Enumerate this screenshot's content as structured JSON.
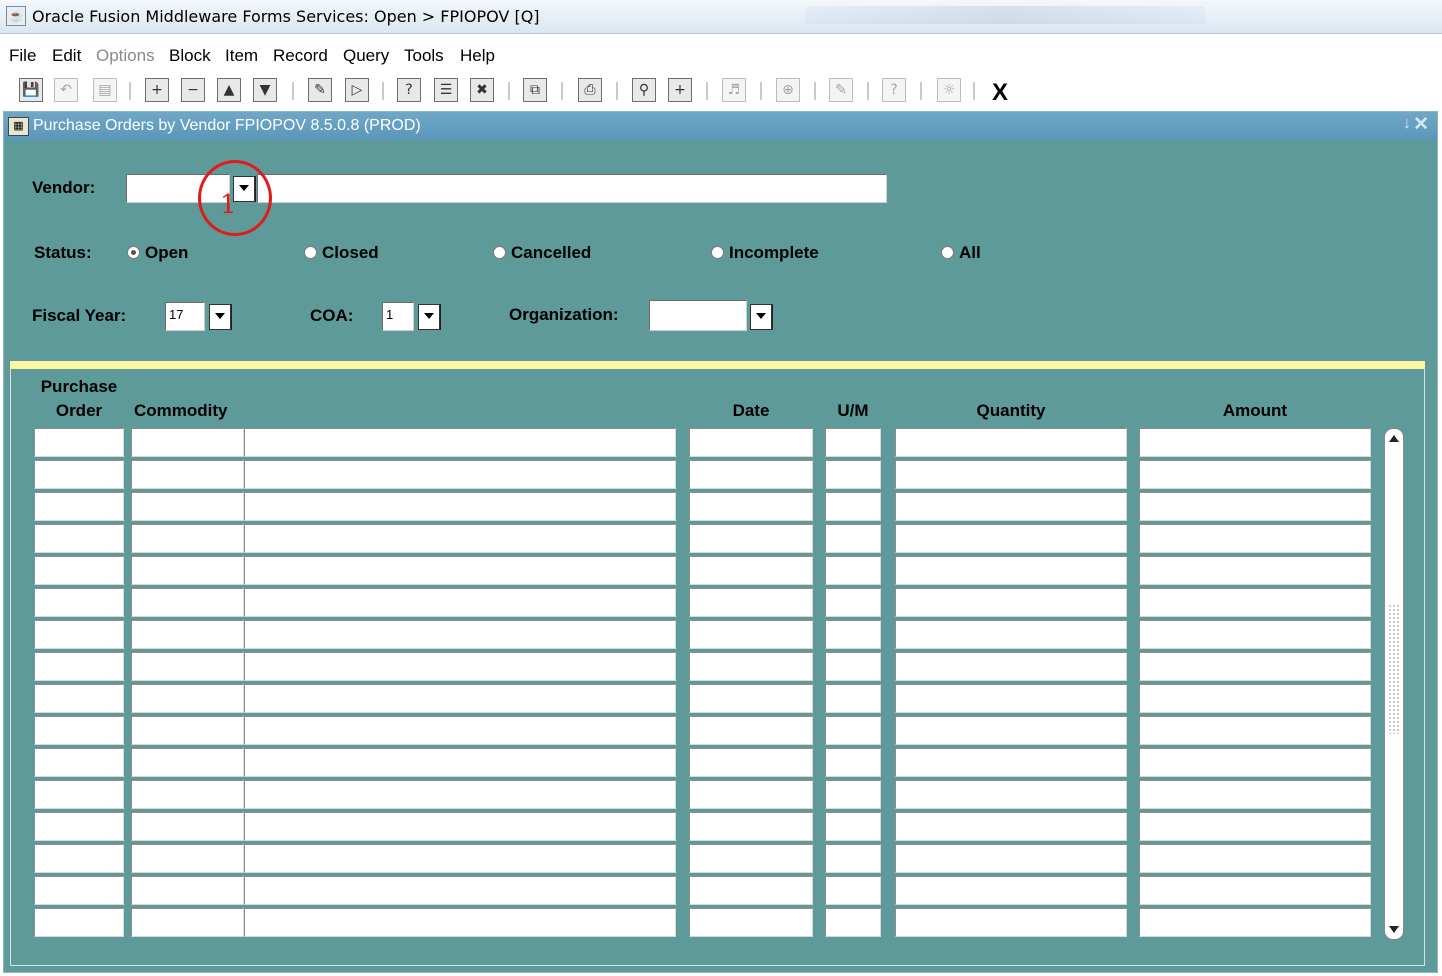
{
  "window": {
    "title": "Oracle Fusion Middleware Forms Services:  Open > FPIOPOV [Q]",
    "app_icon": "java-icon"
  },
  "menu": {
    "file": "File",
    "edit": "Edit",
    "options": "Options",
    "block": "Block",
    "item": "Item",
    "record": "Record",
    "query": "Query",
    "tools": "Tools",
    "help": "Help"
  },
  "toolbar": {
    "icons": [
      "save-icon",
      "rollback-icon",
      "select-icon",
      "insert-record-icon",
      "remove-record-icon",
      "previous-block-icon",
      "next-block-icon",
      "enter-query-icon",
      "execute-query-icon",
      "help-icon",
      "block-help-icon",
      "cancel-query-icon",
      "export-icon",
      "print-icon",
      "search-icon",
      "add-icon",
      "audio-icon",
      "target-icon",
      "options-icon",
      "question-icon",
      "lightbulb-icon"
    ],
    "exit_label": "X"
  },
  "form": {
    "title": "Purchase Orders by Vendor  FPIOPOV  8.5.0.8  (PROD)",
    "minimize_glyph": "↓",
    "close_glyph": "✕"
  },
  "key_block": {
    "vendor_label": "Vendor:",
    "vendor_id": "",
    "vendor_name": "",
    "status_label": "Status:",
    "status_options": [
      {
        "label": "Open",
        "checked": true
      },
      {
        "label": "Closed",
        "checked": false
      },
      {
        "label": "Cancelled",
        "checked": false
      },
      {
        "label": "Incomplete",
        "checked": false
      },
      {
        "label": "All",
        "checked": false
      }
    ],
    "fiscal_year_label": "Fiscal Year:",
    "fiscal_year_value": "17",
    "coa_label": "COA:",
    "coa_value": "1",
    "organization_label": "Organization:",
    "organization_value": ""
  },
  "annotation": {
    "number": "1",
    "color": "#e11a1a"
  },
  "grid": {
    "headers": {
      "purchase_order_line1": "Purchase",
      "purchase_order_line2": "Order",
      "commodity": "Commodity",
      "date": "Date",
      "um": "U/M",
      "quantity": "Quantity",
      "amount": "Amount"
    },
    "row_count": 16
  },
  "colors": {
    "form_background": "#5e9a9a",
    "form_titlebar": "#5b97ba",
    "separator": "#faf7a0"
  }
}
